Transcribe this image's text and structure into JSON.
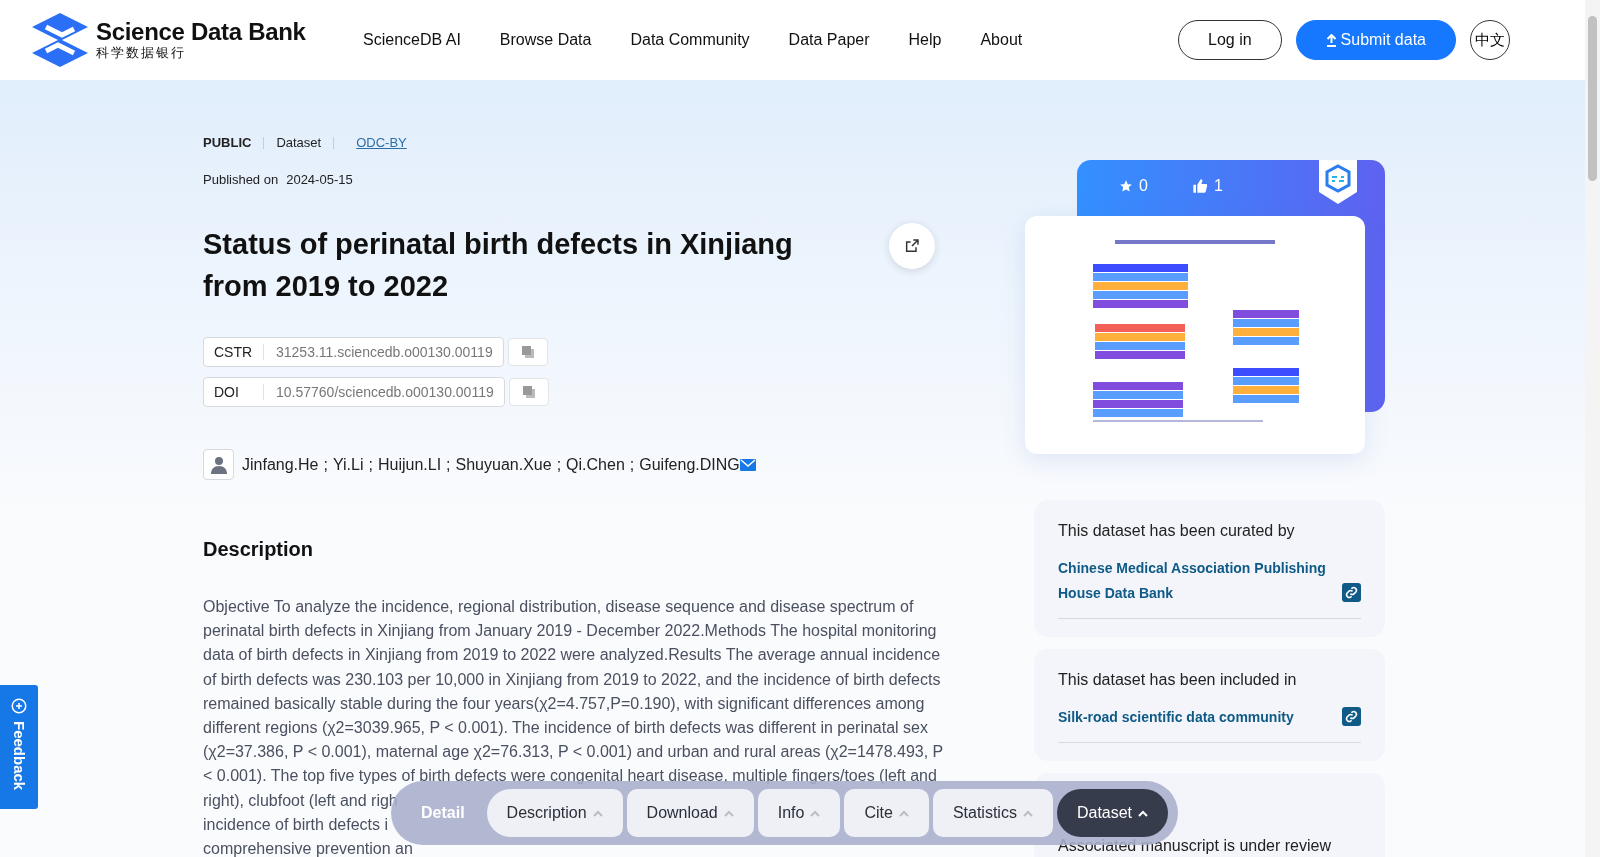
{
  "header": {
    "logo": {
      "name": "Science Data Bank",
      "subtitle": "科学数据银行"
    },
    "nav": [
      "ScienceDB AI",
      "Browse Data",
      "Data Community",
      "Data Paper",
      "Help",
      "About"
    ],
    "login": "Log in",
    "submit": "Submit data",
    "language": "中文"
  },
  "meta": {
    "access": "PUBLIC",
    "type": "Dataset",
    "license": "ODC-BY",
    "published_label": "Published on",
    "published_date": "2024-05-15"
  },
  "title": "Status of perinatal birth defects in Xinjiang from 2019 to 2022",
  "identifiers": [
    {
      "label": "CSTR",
      "value": "31253.11.sciencedb.o00130.00119"
    },
    {
      "label": "DOI",
      "value": "10.57760/sciencedb.o00130.00119"
    }
  ],
  "authors": [
    {
      "name": "Jinfang.He",
      "corresponding": false
    },
    {
      "separator": ";",
      "name": "Yi.Li",
      "corresponding": false
    },
    {
      "separator": ";",
      "name": "Huijun.LI",
      "corresponding": false
    },
    {
      "separator": ";",
      "name": "Shuyuan.Xue",
      "corresponding": false
    },
    {
      "separator": ";",
      "name": "Qi.Chen",
      "corresponding": false
    },
    {
      "separator": ";",
      "name": "Guifeng.DING",
      "corresponding": true
    }
  ],
  "description": {
    "heading": "Description",
    "paragraph": "Objective To analyze the incidence, regional distribution, disease sequence and disease spectrum of perinatal birth defects in Xinjiang from January 2019 - December 2022.Methods The hospital monitoring data of birth defects in Xinjiang from 2019 to 2022 were analyzed.Results The average annual incidence of birth defects was 230.103 per 10,000 in Xinjiang from 2019 to 2022, and the incidence of birth defects remained basically stable during the four years(χ2=4.757,P=0.190), with significant differences among different regions (χ2=3039.965, P < 0.001). The incidence of birth defects was different in perinatal sex (χ2=37.386, P < 0.001), maternal age χ2=76.313, P < 0.001) and urban and rural areas (χ2=1478.493, P < 0.001). The top five types of birth defects were congenital heart disease, multiple fingers/toes (left and",
    "cut_lines": [
      "right), clubfoot (left and righ",
      "incidence of birth defects i",
      "comprehensive prevention an"
    ]
  },
  "stats": {
    "favorites": "0",
    "likes": "1"
  },
  "cards": [
    {
      "title": "This dataset has been curated by",
      "link": "Chinese Medical Association Publishing House Data Bank"
    },
    {
      "title": "This dataset has been included in",
      "link": "Silk-road scientific data community"
    },
    {
      "title": "Associated manuscript is under review"
    }
  ],
  "feedback": "Feedback",
  "section_bar": {
    "label": "Detail",
    "items": [
      {
        "label": "Description",
        "selected": false
      },
      {
        "label": "Download",
        "selected": false
      },
      {
        "label": "Info",
        "selected": false
      },
      {
        "label": "Cite",
        "selected": false
      },
      {
        "label": "Statistics",
        "selected": false
      },
      {
        "label": "Dataset",
        "selected": true
      }
    ]
  }
}
